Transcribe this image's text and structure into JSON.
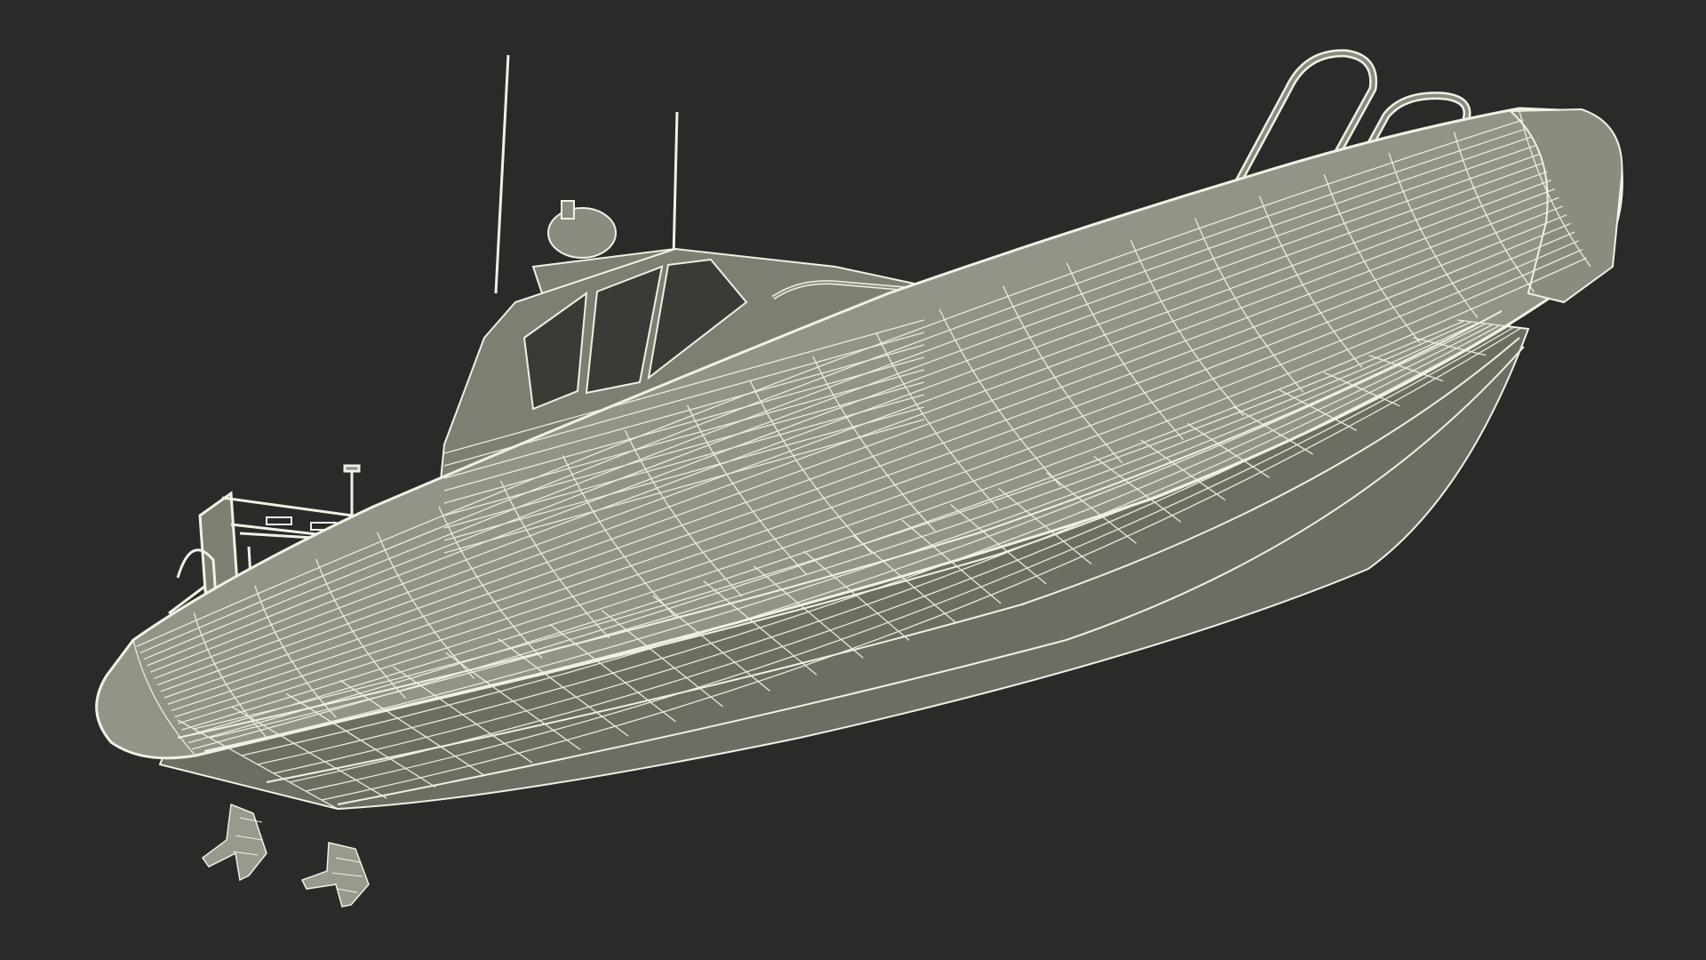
{
  "render": {
    "subject": "boat-wireframe",
    "colors": {
      "background": "#2a2a29",
      "hull_fill": "#8c8b7f",
      "hull_dark": "#6e6d63",
      "tube_fill": "#949387",
      "cabin_fill": "#7f7e73",
      "glass": "#3a3a36",
      "wire": "#f1f0e4",
      "propeller": "#9a998d"
    }
  }
}
